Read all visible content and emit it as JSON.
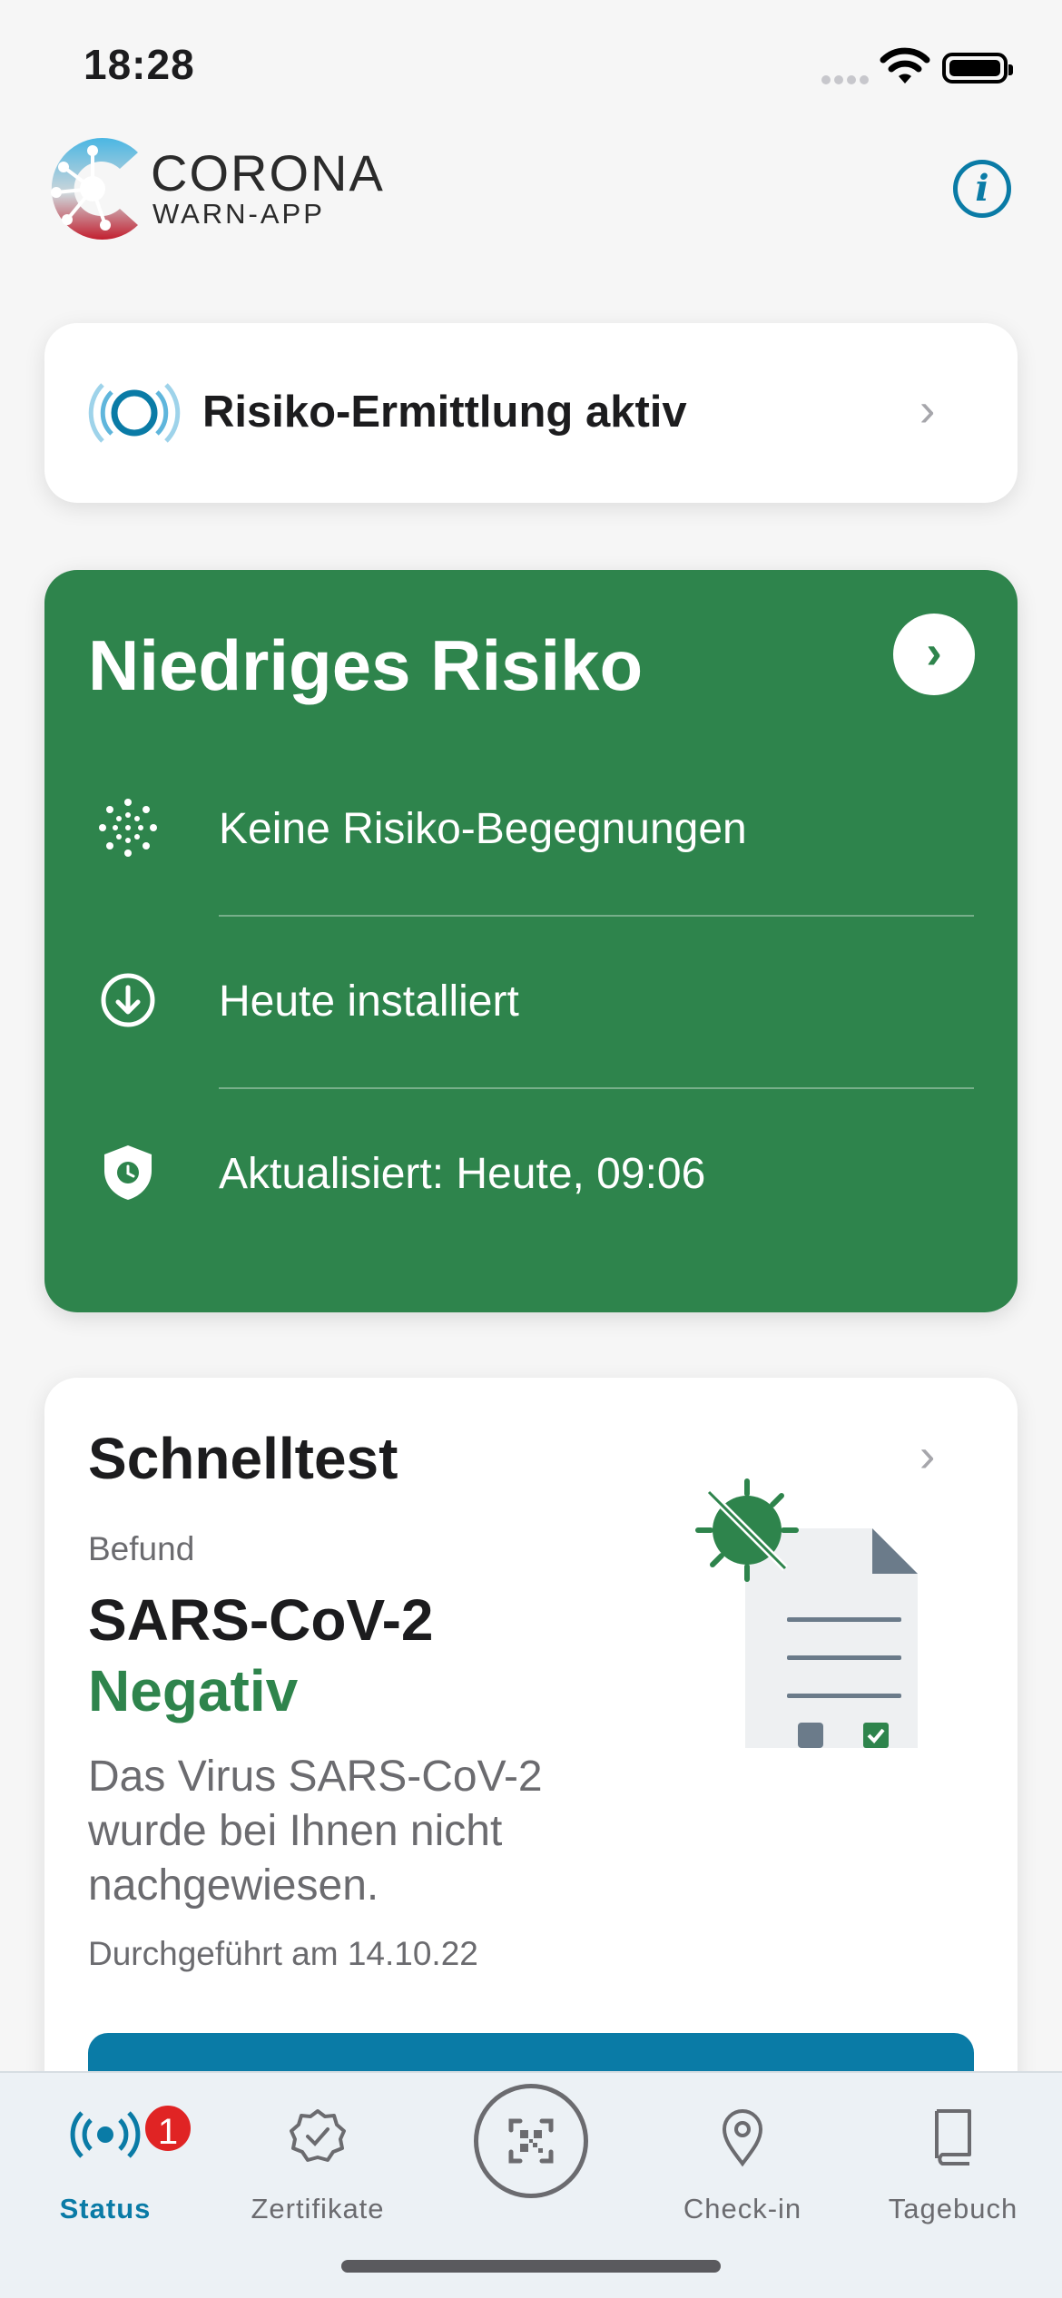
{
  "status_bar": {
    "time": "18:28"
  },
  "header": {
    "logo_title": "CORONA",
    "logo_subtitle": "WARN-APP",
    "info_icon": "info-icon"
  },
  "risk_detection": {
    "label": "Risiko-Ermittlung aktiv",
    "icon": "tracing-active-icon"
  },
  "risk_card": {
    "title": "Niedriges Risiko",
    "color": "#2e844c",
    "rows": [
      {
        "icon": "virus-dots-icon",
        "text": "Keine Risiko-Begegnungen"
      },
      {
        "icon": "download-circle-icon",
        "text": "Heute installiert"
      },
      {
        "icon": "shield-clock-icon",
        "text": "Aktualisiert: Heute, 09:06"
      }
    ]
  },
  "test_card": {
    "title": "Schnelltest",
    "befund_label": "Befund",
    "test_name": "SARS-CoV-2",
    "result": "Negativ",
    "description": "Das Virus SARS-CoV-2 wurde bei Ihnen nicht nachgewiesen.",
    "date": "Durchgeführt am 14.10.22"
  },
  "tabbar": {
    "tabs": [
      {
        "label": "Status",
        "icon": "tracing-icon",
        "badge": "1",
        "active": true
      },
      {
        "label": "Zertifikate",
        "icon": "certificate-icon"
      },
      {
        "label": "",
        "icon": "qr-scan-icon"
      },
      {
        "label": "Check-in",
        "icon": "location-pin-icon"
      },
      {
        "label": "Tagebuch",
        "icon": "book-icon"
      }
    ]
  },
  "colors": {
    "accent": "#0a7ba6",
    "risk_low": "#2e844c",
    "badge": "#e02424"
  }
}
